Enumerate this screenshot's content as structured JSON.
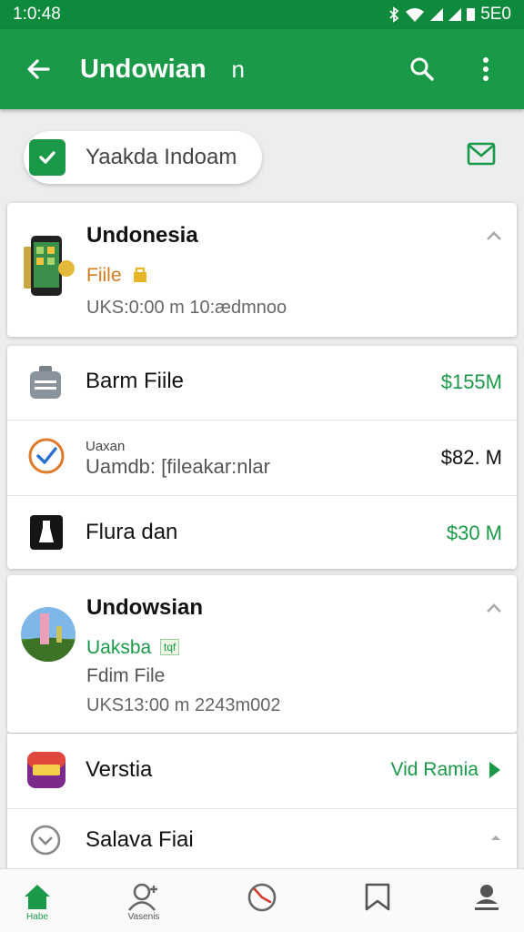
{
  "status_bar": {
    "time": "1:0:48",
    "battery": "5E0"
  },
  "app_bar": {
    "title": "Undowian",
    "subtitle": "n"
  },
  "filter": {
    "chip_label": "Yaakda Indoam"
  },
  "card1": {
    "title": "Undonesia",
    "tag": "Fiile",
    "subtitle": "UKS:0:00 m 10:ædmnoo"
  },
  "list1": [
    {
      "label": "Barm Fiile",
      "value": "$155M",
      "value_color": "#1a9a48"
    },
    {
      "label_small": "Uaxan",
      "label": "Uamdb: [fileakar:nlar",
      "value": "$82. M",
      "value_color": "#111111"
    },
    {
      "label": "Flura dan",
      "value": "$30 M",
      "value_color": "#1a9a48"
    }
  ],
  "card2": {
    "title": "Undowsian",
    "tag": "Uaksba",
    "tag_badge": "tqf",
    "line2": "Fdim File",
    "subtitle": "UKS13:00 m 2243m002"
  },
  "list2": [
    {
      "label": "Verstia",
      "value": "Vid Ramia",
      "value_color": "#1a9a48"
    },
    {
      "label": "Salava Fiai"
    }
  ],
  "bottom_nav": [
    {
      "label": "Habe",
      "icon": "home-icon",
      "active": true
    },
    {
      "label": "Vasenis",
      "icon": "person-add-icon",
      "active": false
    },
    {
      "label": "",
      "icon": "clock-icon",
      "active": false
    },
    {
      "label": "",
      "icon": "bookmark-icon",
      "active": false
    },
    {
      "label": "",
      "icon": "account-icon",
      "active": false
    }
  ],
  "colors": {
    "primary": "#1a9a48",
    "status_bar": "#0e8a3c",
    "tag_orange": "#d67a1a"
  }
}
